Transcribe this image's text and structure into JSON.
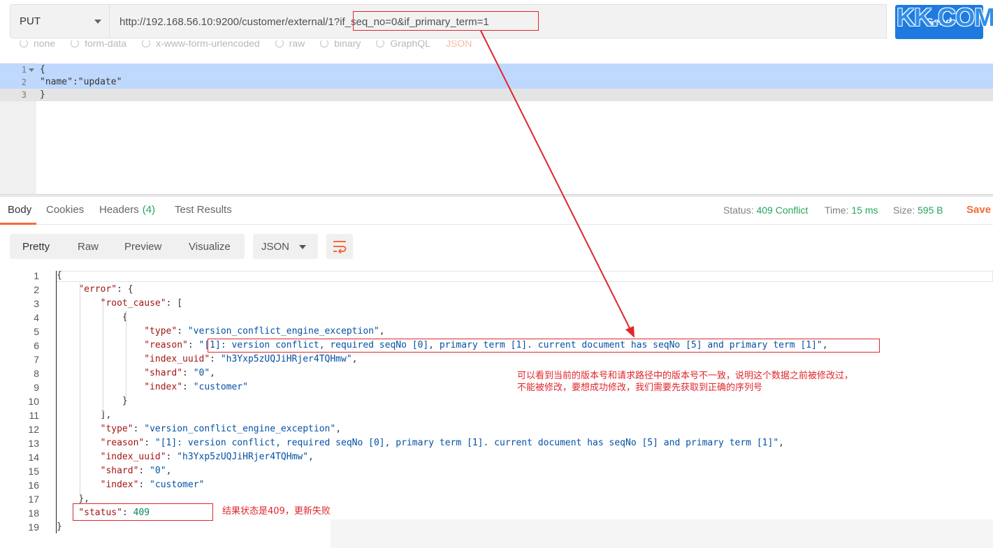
{
  "request": {
    "method": "PUT",
    "url": "http://192.168.56.10:9200/customer/external/1?if_seq_no=0&if_primary_term=1",
    "send_label": "Send",
    "watermark": "KK.COM",
    "body_types": [
      "none",
      "form-data",
      "x-www-form-urlencoded",
      "raw",
      "binary",
      "GraphQL",
      "JSON"
    ],
    "body_lines": [
      {
        "num": "1",
        "code": "{"
      },
      {
        "num": "2",
        "code": "\"name\":\"update\""
      },
      {
        "num": "3",
        "code": "}"
      }
    ]
  },
  "response": {
    "tabs": [
      {
        "label": "Body",
        "count": ""
      },
      {
        "label": "Cookies",
        "count": ""
      },
      {
        "label": "Headers",
        "count": "(4)"
      },
      {
        "label": "Test Results",
        "count": ""
      }
    ],
    "status_label": "Status:",
    "status_value": "409 Conflict",
    "time_label": "Time:",
    "time_value": "15 ms",
    "size_label": "Size:",
    "size_value": "595 B",
    "save_label": "Save",
    "view_modes": [
      "Pretty",
      "Raw",
      "Preview",
      "Visualize"
    ],
    "format": "JSON",
    "lines": [
      {
        "num": "1",
        "code": "{"
      },
      {
        "num": "2",
        "code": "    \"error\": {"
      },
      {
        "num": "3",
        "code": "        \"root_cause\": ["
      },
      {
        "num": "4",
        "code": "            {"
      },
      {
        "num": "5",
        "code": "                \"type\": \"version_conflict_engine_exception\","
      },
      {
        "num": "6",
        "code": "                \"reason\": \"[1]: version conflict, required seqNo [0], primary term [1]. current document has seqNo [5] and primary term [1]\","
      },
      {
        "num": "7",
        "code": "                \"index_uuid\": \"h3Yxp5zUQJiHRjer4TQHmw\","
      },
      {
        "num": "8",
        "code": "                \"shard\": \"0\","
      },
      {
        "num": "9",
        "code": "                \"index\": \"customer\""
      },
      {
        "num": "10",
        "code": "            }"
      },
      {
        "num": "11",
        "code": "        ],"
      },
      {
        "num": "12",
        "code": "        \"type\": \"version_conflict_engine_exception\","
      },
      {
        "num": "13",
        "code": "        \"reason\": \"[1]: version conflict, required seqNo [0], primary term [1]. current document has seqNo [5] and primary term [1]\","
      },
      {
        "num": "14",
        "code": "        \"index_uuid\": \"h3Yxp5zUQJiHRjer4TQHmw\","
      },
      {
        "num": "15",
        "code": "        \"shard\": \"0\","
      },
      {
        "num": "16",
        "code": "        \"index\": \"customer\""
      },
      {
        "num": "17",
        "code": "    },"
      },
      {
        "num": "18",
        "code": "    \"status\": 409"
      },
      {
        "num": "19",
        "code": "}"
      }
    ]
  },
  "annotations": {
    "note_version": "可以看到当前的版本号和请求路径中的版本号不一致，说明这个数据之前被修改过，\n不能被修改，要想成功修改，我们需要先获取到正确的序列号",
    "note_status": "结果状态是409，更新失败",
    "color": "#e0262c"
  }
}
